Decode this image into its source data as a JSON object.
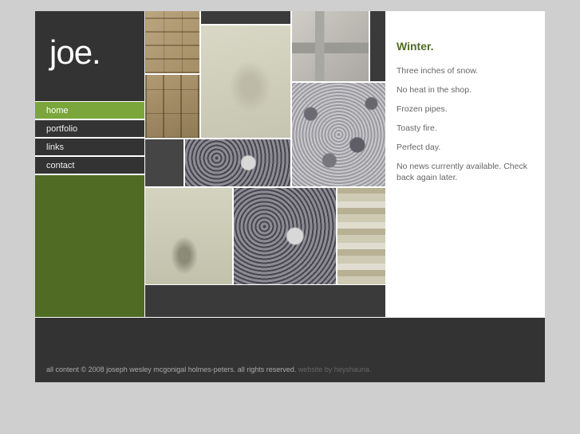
{
  "logo": {
    "text": "joe."
  },
  "nav": {
    "items": [
      {
        "label": "home"
      },
      {
        "label": "portfolio"
      },
      {
        "label": "links"
      },
      {
        "label": "contact"
      }
    ]
  },
  "gallery": {
    "tiles": [
      {
        "subject": "wood-blocks-image"
      },
      {
        "subject": "dark-panel"
      },
      {
        "subject": "white-models-image"
      },
      {
        "subject": "crushed-material-image"
      },
      {
        "subject": "wood-grid-image"
      },
      {
        "subject": "gravel-texture-image"
      },
      {
        "subject": "gravel-model-image"
      },
      {
        "subject": "plaster-fragments-image"
      },
      {
        "subject": "model-on-gravel-image"
      },
      {
        "subject": "striped-texture-image"
      }
    ]
  },
  "news": {
    "heading": "Winter.",
    "lines": [
      "Three inches of snow.",
      "No heat in the shop.",
      "Frozen pipes.",
      "Toasty fire.",
      "Perfect day.",
      "No news currently available. Check back again later."
    ]
  },
  "footer": {
    "copyright": "all content © 2008 joseph wesley mcgonigal holmes-peters. all rights reserved.",
    "credit": "website by heyshauna."
  },
  "colors": {
    "accent_active": "#7aa63c",
    "nav_fill": "#4f6b24",
    "heading": "#4f6b24",
    "dark": "#333333",
    "page_bg": "#cfcfcf"
  }
}
